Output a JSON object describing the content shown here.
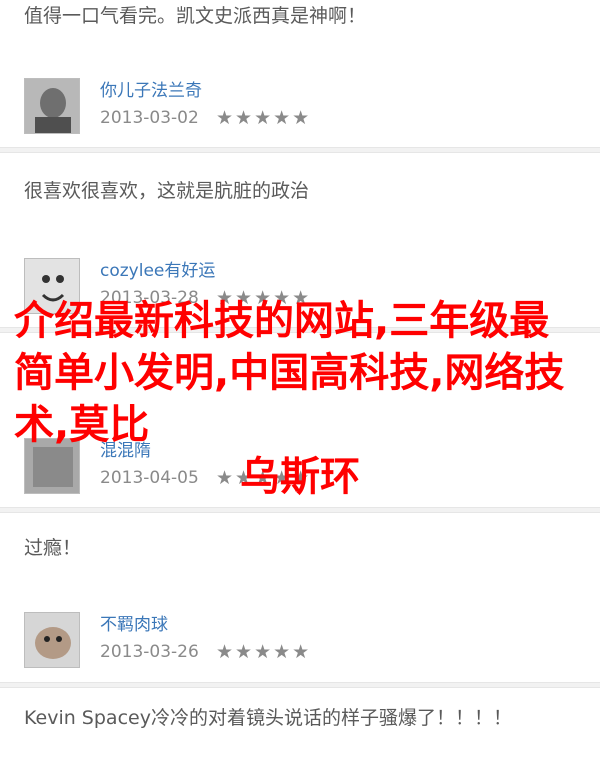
{
  "comments": [
    {
      "text": "值得一口气看完。凯文史派西真是神啊！"
    },
    {
      "text": "很喜欢很喜欢，这就是肮脏的政治"
    },
    {
      "text": "过瘾！"
    },
    {
      "text": "Kevin Spacey冷冷的对着镜头说话的样子骚爆了！！！！"
    }
  ],
  "users": [
    {
      "name": "你儿子法兰奇",
      "date": "2013-03-02",
      "stars": "★★★★★"
    },
    {
      "name": "cozylee有好运",
      "date": "2013-03-28",
      "stars": "★★★★★"
    },
    {
      "name": "混混隋",
      "date": "2013-04-05",
      "stars": "★★★★★"
    },
    {
      "name": "不羁肉球",
      "date": "2013-03-26",
      "stars": "★★★★★"
    }
  ],
  "overlay": {
    "line1": "介绍最新科技的网站,三年级最简单小发明,中国高科技,网络技术,莫比",
    "line2": "乌斯环"
  },
  "colors": {
    "overlay_text": "#ff0000",
    "username": "#3b77b8"
  }
}
